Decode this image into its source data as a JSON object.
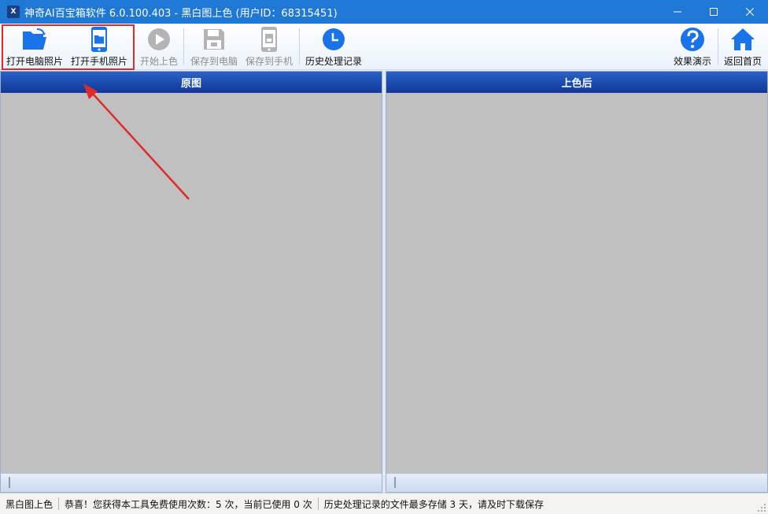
{
  "window": {
    "title": "神奇AI百宝箱软件 6.0.100.403 - 黑白图上色 (用户ID：68315451)",
    "app_icon_text": "X",
    "accent": "#1e78d4"
  },
  "toolbar": {
    "open_pc": "打开电脑照片",
    "open_phone": "打开手机照片",
    "start_color": "开始上色",
    "save_pc": "保存到电脑",
    "save_phone": "保存到手机",
    "history": "历史处理记录",
    "demo": "效果演示",
    "home": "返回首页"
  },
  "panels": {
    "left_title": "原图",
    "right_title": "上色后"
  },
  "status": {
    "mode": "黑白图上色",
    "quota": "恭喜！您获得本工具免费使用次数：5 次，当前已使用 0 次",
    "retention": "历史处理记录的文件最多存储 3 天，请及时下载保存"
  },
  "icons": {
    "open_pc": "folder-open-icon",
    "open_phone": "phone-folder-icon",
    "start_color": "play-icon",
    "save_pc": "floppy-disk-icon",
    "save_phone": "phone-save-icon",
    "history": "clock-icon",
    "demo": "question-icon",
    "home": "home-icon"
  },
  "colors": {
    "icon_blue": "#1a73e8",
    "disabled_gray": "#b4b4b4",
    "highlight_red": "#e02a2a",
    "panel_header": "#1a45a8"
  }
}
